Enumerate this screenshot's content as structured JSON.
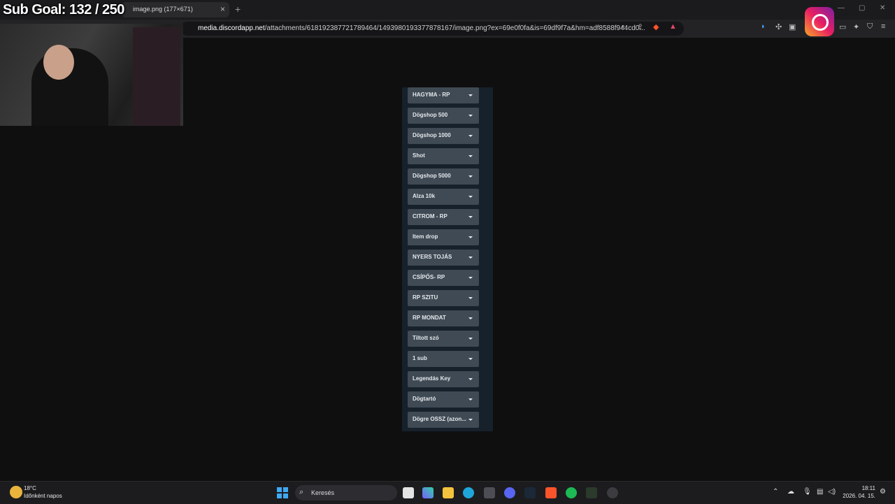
{
  "overlay": {
    "sub_goal": "Sub Goal:  132 / 250"
  },
  "browser": {
    "tab_title": "image.png (177×671)",
    "url_host": "media.discordapp.net",
    "url_path": "/attachments/618192387721789464/1493980193377878167/image.png?ex=69e0f0fa&is=69df9f7a&hm=adf8588f944cd0...",
    "new_tab": "+",
    "close": "×",
    "min": "—",
    "max": "▢",
    "winclose": "✕"
  },
  "menu": {
    "items": [
      "HAGYMA - RP",
      "Dögshop 500",
      "Dögshop 1000",
      "Shot",
      "Dögshop 5000",
      "Alza 10k",
      "CITROM - RP",
      "Item drop",
      "NYERS TOJÁS",
      "CSÍPŐS- RP",
      "RP SZITU",
      "RP MONDAT",
      "Tiltott szó",
      "1 sub",
      "Legendás Key",
      "Dögtartó",
      "Dögre OSSZ (azon..."
    ]
  },
  "taskbar": {
    "temperature": "18°C",
    "condition": "Időnként napos",
    "search_placeholder": "Keresés",
    "time": "18:11",
    "date": "2026. 04. 15."
  },
  "colors": {
    "panel_bg": "#16212b",
    "button_bg": "#3f4a54",
    "page_bg": "#0f0f10",
    "accent": "#3fa9f5"
  }
}
